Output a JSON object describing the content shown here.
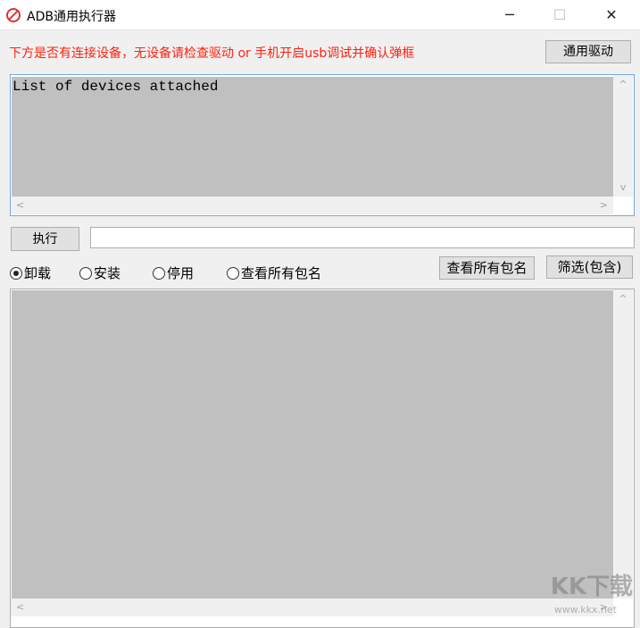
{
  "window": {
    "title": "ADB通用执行器",
    "minimize": "─",
    "maximize": "☐",
    "close": "✕"
  },
  "header": {
    "hint": "下方是否有连接设备，无设备请检查驱动 or 手机开启usb调试并确认弹框",
    "driver_button": "通用驱动"
  },
  "device_output": {
    "text": "List of devices attached"
  },
  "command": {
    "execute_button": "执行",
    "input_value": ""
  },
  "modes": [
    {
      "label": "卸载",
      "checked": true
    },
    {
      "label": "安装",
      "checked": false
    },
    {
      "label": "停用",
      "checked": false
    },
    {
      "label": "查看所有包名",
      "checked": false
    }
  ],
  "actions": {
    "list_packages_button": "查看所有包名",
    "filter_button": "筛选(包含)"
  },
  "output": {
    "text": ""
  },
  "scroll": {
    "up": "^",
    "down": "v",
    "left": "<",
    "right": ">"
  },
  "watermark": {
    "logo": "KK下载",
    "url": "www.kkx.net"
  }
}
